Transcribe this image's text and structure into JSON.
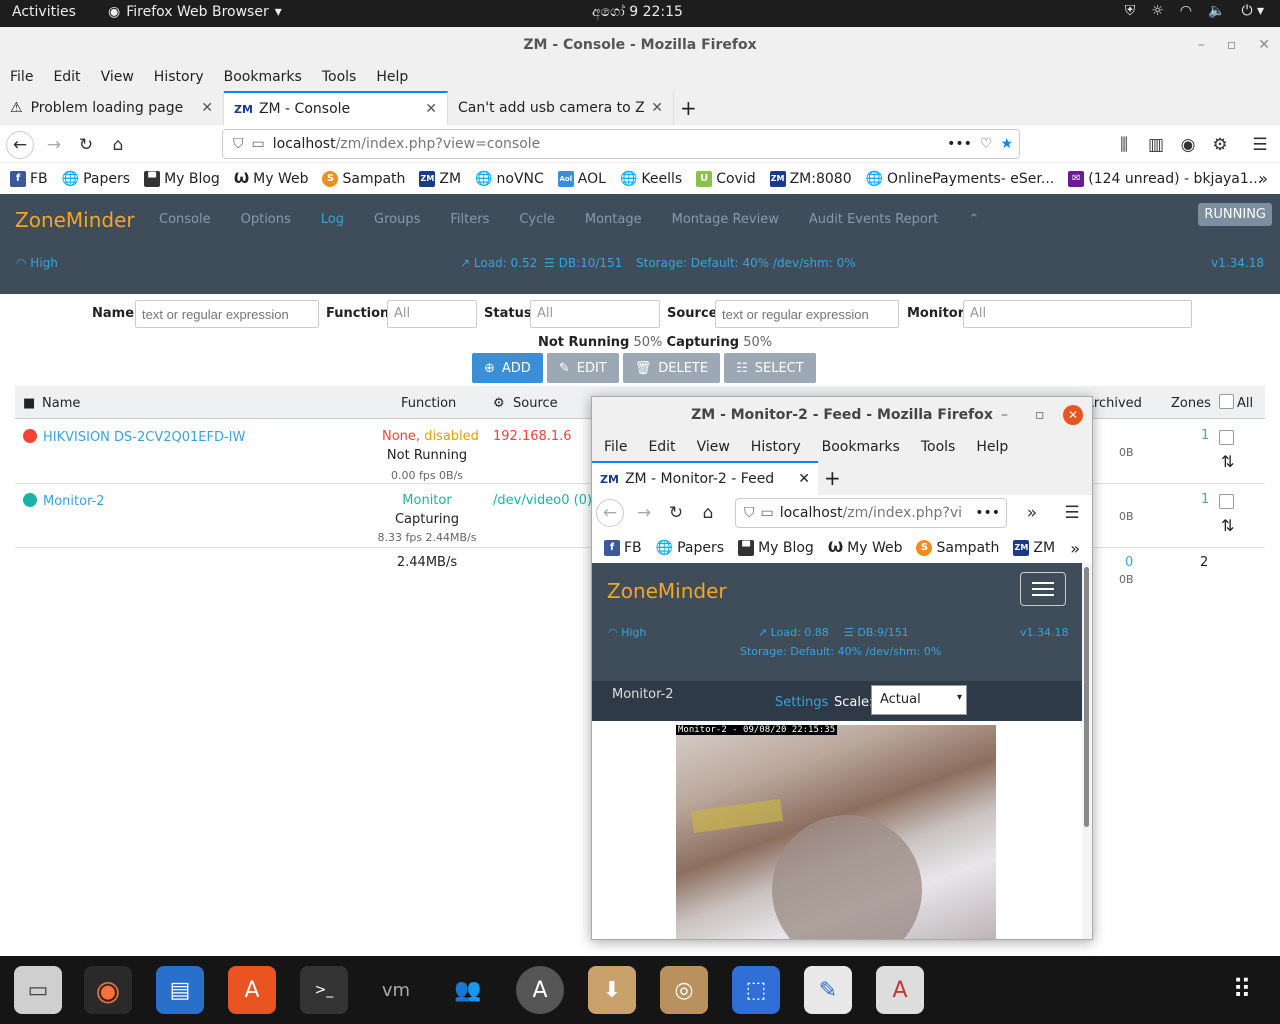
{
  "topbar": {
    "activities": "Activities",
    "app_name": "Firefox Web Browser",
    "clock": "අගෝ 9  22:15",
    "tray_icons": [
      "shield-icon",
      "brightness-icon",
      "wifi-icon",
      "volume-icon",
      "power-icon"
    ]
  },
  "window": {
    "title": "ZM - Console - Mozilla Firefox",
    "menu": [
      "File",
      "Edit",
      "View",
      "History",
      "Bookmarks",
      "Tools",
      "Help"
    ],
    "tabs": [
      {
        "label": "Problem loading page",
        "icon": "warning-icon"
      },
      {
        "label": "ZM - Console",
        "icon": "zm-icon",
        "active": true
      },
      {
        "label": "Can't add usb camera to Zon",
        "icon": "none"
      }
    ],
    "url_host": "localhost",
    "url_path": "/zm/index.php?view=console",
    "url_more": "•••",
    "bookmarks": [
      {
        "label": "FB",
        "icon": "facebook-icon"
      },
      {
        "label": "Papers",
        "icon": "globe-icon"
      },
      {
        "label": "My Blog",
        "icon": "blog-icon"
      },
      {
        "label": "My Web",
        "icon": "web-icon"
      },
      {
        "label": "Sampath",
        "icon": "sampath-icon"
      },
      {
        "label": "ZM",
        "icon": "zm-icon"
      },
      {
        "label": "noVNC",
        "icon": "globe-icon"
      },
      {
        "label": "AOL",
        "icon": "aol-icon"
      },
      {
        "label": "Keells",
        "icon": "globe-icon"
      },
      {
        "label": "Covid",
        "icon": "covid-icon"
      },
      {
        "label": "ZM:8080",
        "icon": "zm-icon"
      },
      {
        "label": "OnlinePayments- eSer...",
        "icon": "globe-icon"
      },
      {
        "label": "(124 unread) - bkjaya1...",
        "icon": "mail-icon"
      }
    ]
  },
  "zm": {
    "brand": "ZoneMinder",
    "nav": [
      "Console",
      "Options",
      "Log",
      "Groups",
      "Filters",
      "Cycle",
      "Montage",
      "Montage Review",
      "Audit Events Report"
    ],
    "active_nav": "Log",
    "run_state": "RUNNING",
    "bandwidth": "High",
    "load": "Load: 0.52",
    "db": "DB:10/151",
    "storage": "Storage: Default: 40% /dev/shm: 0%",
    "version": "v1.34.18",
    "filters": {
      "name_label": "Name",
      "name_placeholder": "text or regular expression",
      "function_label": "Function",
      "function_value": "All",
      "status_label": "Status",
      "status_value": "All",
      "source_label": "Source",
      "source_placeholder": "text or regular expression",
      "monitor_label": "Monitor",
      "monitor_value": "All"
    },
    "counts": {
      "not_running": "Not Running",
      "not_running_pct": "50%",
      "capturing": "Capturing",
      "capturing_pct": "50%"
    },
    "actions": {
      "add": "ADD",
      "edit": "EDIT",
      "delete": "DELETE",
      "select": "SELECT"
    },
    "table": {
      "headers": {
        "name": "Name",
        "function": "Function",
        "source": "Source",
        "archived": "Archived",
        "zones": "Zones",
        "all": "All"
      },
      "rows": [
        {
          "name": "HIKVISION DS-2CV2Q01EFD-IW",
          "status_color": "#f44336",
          "function_a": "None",
          "function_b": "disabled",
          "state": "Not Running",
          "fps": "0.00 fps 0B/s",
          "source": "192.168.1.6",
          "archived": "0B",
          "zones": "1"
        },
        {
          "name": "Monitor-2",
          "status_color": "#1bb3a8",
          "function_a": "Monitor",
          "function_b": "",
          "state": "Capturing",
          "fps": "8.33 fps 2.44MB/s",
          "source": "/dev/video0 (0)",
          "archived": "0B",
          "zones": "1"
        }
      ],
      "footer": {
        "bandwidth": "2.44MB/s",
        "archived_count": "0",
        "archived_size": "0B",
        "zones": "2"
      }
    }
  },
  "popup": {
    "title": "ZM - Monitor-2 - Feed - Mozilla Firefox",
    "menu": [
      "File",
      "Edit",
      "View",
      "History",
      "Bookmarks",
      "Tools",
      "Help"
    ],
    "tab": "ZM - Monitor-2 - Feed",
    "url_host": "localhost",
    "url_path": "/zm/index.php?vi",
    "bookmarks": [
      "FB",
      "Papers",
      "My Blog",
      "My Web",
      "Sampath",
      "ZM"
    ],
    "brand": "ZoneMinder",
    "bandwidth": "High",
    "load": "Load: 0.88",
    "db": "DB:9/151",
    "version": "v1.34.18",
    "storage": "Storage: Default: 40% /dev/shm: 0%",
    "monitor": "Monitor-2",
    "settings": "Settings",
    "scale_label": "Scale:",
    "scale_value": "Actual",
    "stamp": "Monitor-2 - 09/08/20 22:15:35"
  },
  "dock": [
    "files-icon",
    "firefox-icon",
    "writer-icon",
    "software-icon",
    "terminal-icon",
    "vm-icon",
    "users-icon",
    "updater-icon",
    "archive-icon",
    "package-icon",
    "screenshot-icon",
    "editor-icon",
    "document-viewer-icon"
  ]
}
